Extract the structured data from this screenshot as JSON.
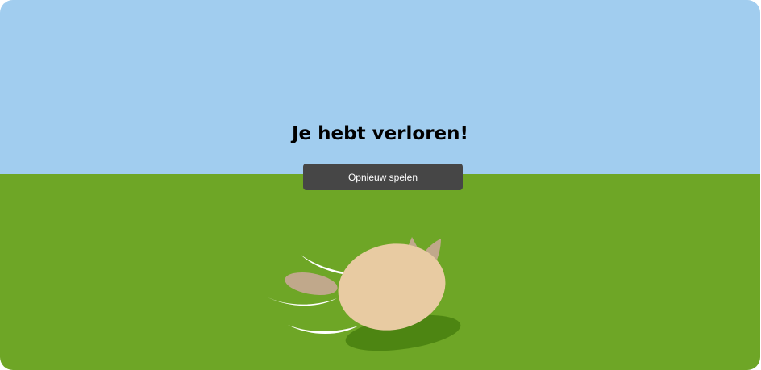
{
  "game": {
    "message": "Je hebt verloren!",
    "restart_label": "Opnieuw spelen"
  },
  "colors": {
    "sky": "#a1cdef",
    "ground": "#6ea626",
    "shadow": "#4d8512",
    "body": "#e8cba2",
    "ear": "#c0a88b",
    "button": "#464646",
    "motion_lines": "#ffffff"
  }
}
